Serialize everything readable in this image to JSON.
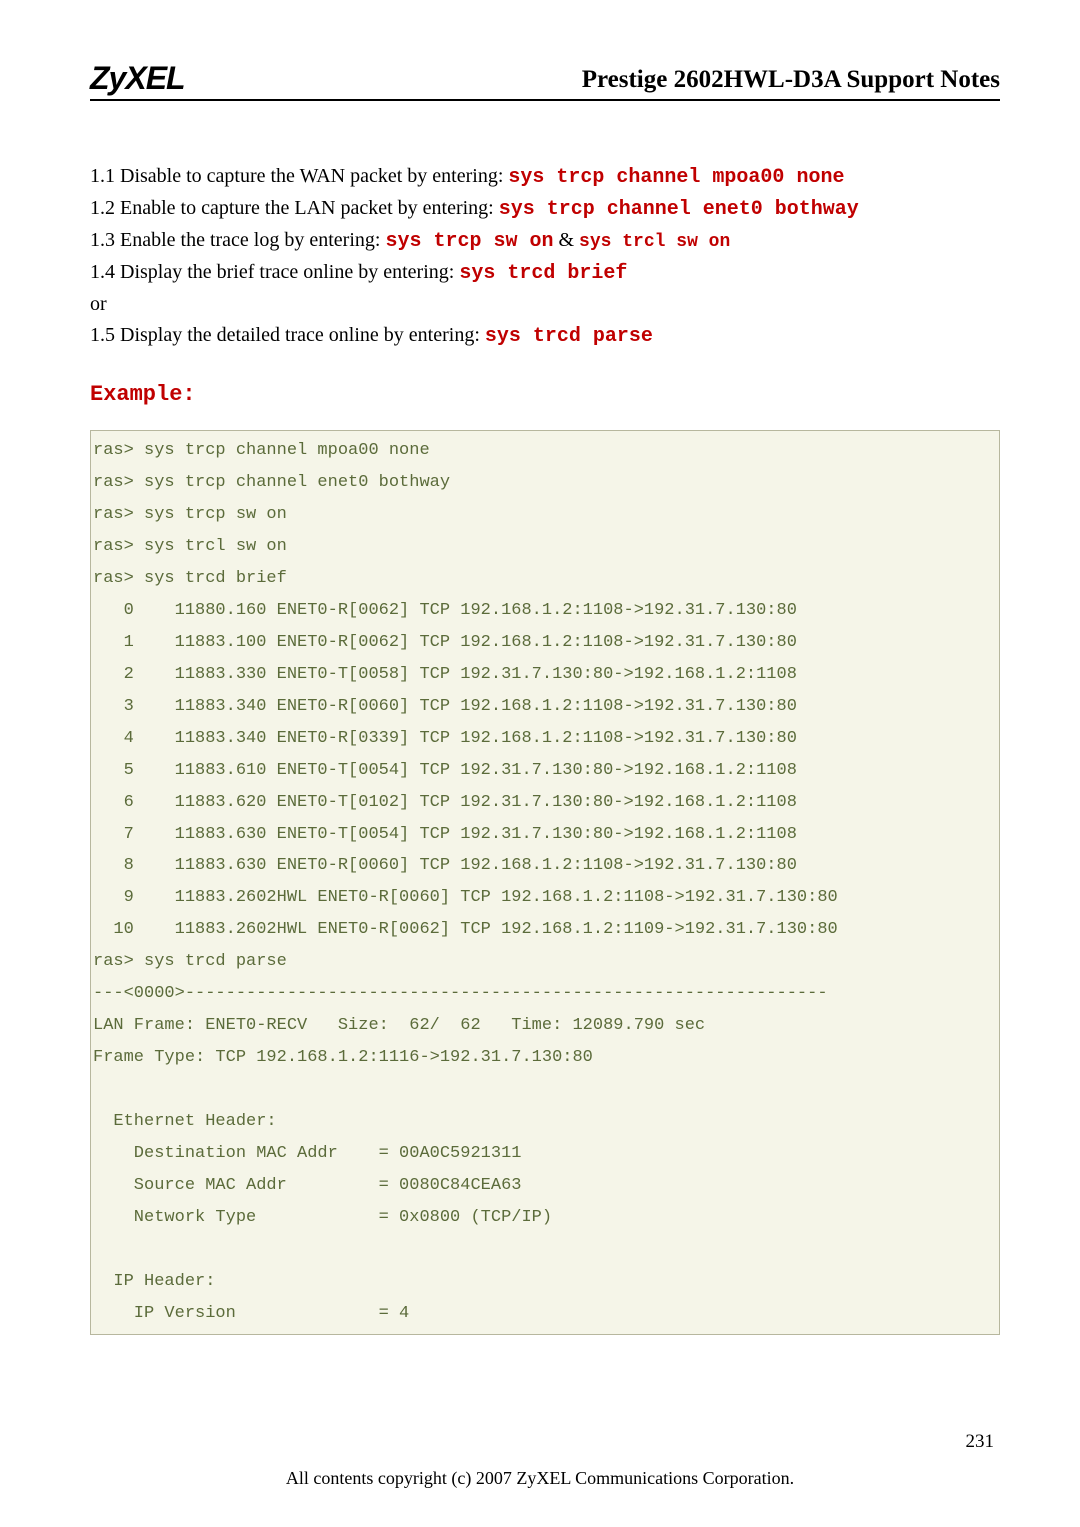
{
  "header": {
    "logo": "ZyXEL",
    "title": "Prestige 2602HWL-D3A Support Notes"
  },
  "body": {
    "line1_prefix": "1.1 Disable to capture the WAN packet by entering: ",
    "line1_cmd": "sys trcp channel mpoa00 none",
    "line2_prefix": "1.2 Enable to capture the LAN packet by entering: ",
    "line2_cmd": "sys trcp channel enet0 bothway",
    "line3_prefix": "1.3 Enable the trace log by entering: ",
    "line3_cmd": "sys trcp sw on",
    "line3_amp": " & ",
    "line3_cmd2": "sys trcl sw on",
    "line4_prefix": "1.4 Display the brief trace online by entering: ",
    "line4_cmd": "sys trcd brief",
    "line_or": "or",
    "line5_prefix": "1.5 Display the detailed trace online by entering: ",
    "line5_cmd": "sys trcd parse",
    "example_label": "Example:"
  },
  "code": "ras> sys trcp channel mpoa00 none\nras> sys trcp channel enet0 bothway\nras> sys trcp sw on\nras> sys trcl sw on\nras> sys trcd brief\n   0    11880.160 ENET0-R[0062] TCP 192.168.1.2:1108->192.31.7.130:80\n   1    11883.100 ENET0-R[0062] TCP 192.168.1.2:1108->192.31.7.130:80\n   2    11883.330 ENET0-T[0058] TCP 192.31.7.130:80->192.168.1.2:1108\n   3    11883.340 ENET0-R[0060] TCP 192.168.1.2:1108->192.31.7.130:80\n   4    11883.340 ENET0-R[0339] TCP 192.168.1.2:1108->192.31.7.130:80\n   5    11883.610 ENET0-T[0054] TCP 192.31.7.130:80->192.168.1.2:1108\n   6    11883.620 ENET0-T[0102] TCP 192.31.7.130:80->192.168.1.2:1108\n   7    11883.630 ENET0-T[0054] TCP 192.31.7.130:80->192.168.1.2:1108\n   8    11883.630 ENET0-R[0060] TCP 192.168.1.2:1108->192.31.7.130:80\n   9    11883.2602HWL ENET0-R[0060] TCP 192.168.1.2:1108->192.31.7.130:80\n  10    11883.2602HWL ENET0-R[0062] TCP 192.168.1.2:1109->192.31.7.130:80\nras> sys trcd parse\n---<0000>---------------------------------------------------------------\nLAN Frame: ENET0-RECV   Size:  62/  62   Time: 12089.790 sec\nFrame Type: TCP 192.168.1.2:1116->192.31.7.130:80\n\n  Ethernet Header:\n    Destination MAC Addr    = 00A0C5921311\n    Source MAC Addr         = 0080C84CEA63\n    Network Type            = 0x0800 (TCP/IP)\n\n  IP Header:\n    IP Version              = 4",
  "footer": {
    "copyright": "All contents copyright (c) 2007 ZyXEL Communications Corporation.",
    "page_num": "231"
  }
}
